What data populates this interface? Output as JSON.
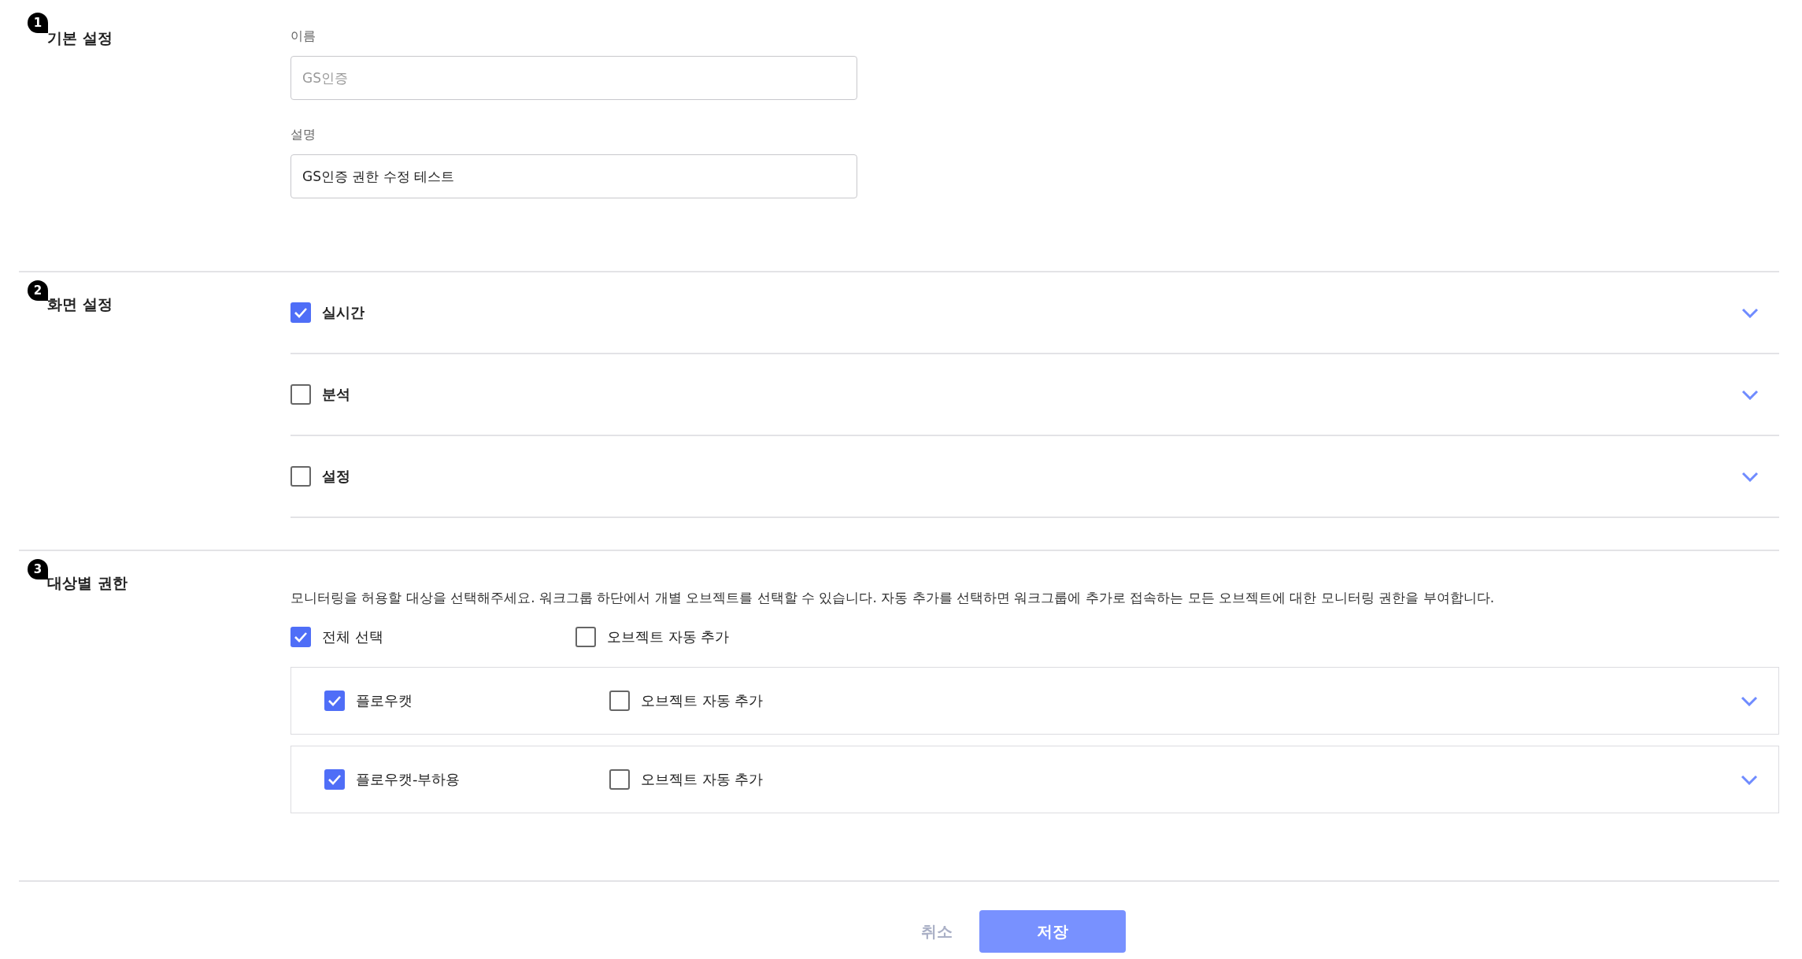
{
  "basic": {
    "badge": "1",
    "title": "기본 설정",
    "fields": [
      {
        "label": "이름",
        "placeholder": "GS인증"
      },
      {
        "label": "설명",
        "value": "GS인증 권한 수정 테스트"
      }
    ]
  },
  "screen": {
    "badge": "2",
    "title": "화면 설정",
    "items": [
      {
        "label": "실시간",
        "checked": true
      },
      {
        "label": "분석",
        "checked": false
      },
      {
        "label": "설정",
        "checked": false
      }
    ]
  },
  "targets": {
    "badge": "3",
    "title": "대상별 권한",
    "description": "모니터링을 허용할 대상을 선택해주세요. 워크그룹 하단에서 개별 오브젝트를 선택할 수 있습니다. 자동 추가를 선택하면 워크그룹에 추가로 접속하는 모든 오브젝트에 대한 모니터링 권한을 부여합니다.",
    "select_all": {
      "label": "전체 선택",
      "checked": true,
      "auto_add": {
        "label": "오브젝트 자동 추가",
        "checked": false
      }
    },
    "groups": [
      {
        "label": "플로우캣",
        "checked": true,
        "auto_add": {
          "label": "오브젝트 자동 추가",
          "checked": false
        }
      },
      {
        "label": "플로우캣-부하용",
        "checked": true,
        "auto_add": {
          "label": "오브젝트 자동 추가",
          "checked": false
        }
      }
    ]
  },
  "buttons": {
    "cancel": "취소",
    "save": "저장"
  }
}
